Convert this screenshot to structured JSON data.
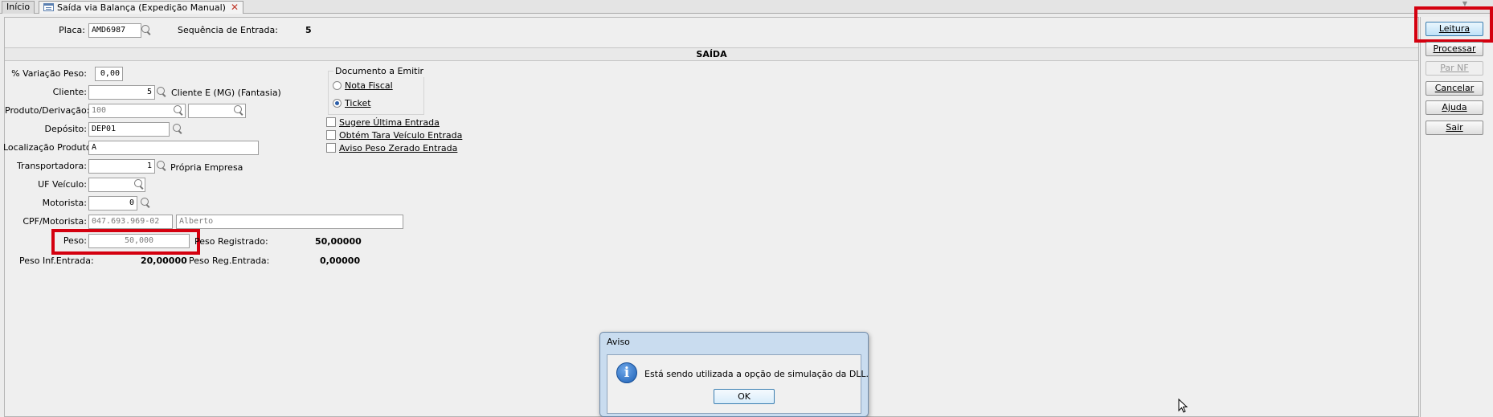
{
  "tabs": [
    {
      "label": "Início"
    },
    {
      "label": "Saída via Balança (Expedição Manual)"
    }
  ],
  "header": {
    "placa_label": "Placa:",
    "placa_value": "AMD6987",
    "sequencia_label": "Sequência de Entrada:",
    "sequencia_value": "5"
  },
  "section_title": "SAÍDA",
  "form": {
    "variacao_label": "% Variação Peso:",
    "variacao_value": "0,00",
    "cliente_label": "Cliente:",
    "cliente_value": "5",
    "cliente_name": "Cliente E (MG) (Fantasia)",
    "produto_label": "Produto/Derivação:",
    "produto_value": "100",
    "derivacao_value": "",
    "deposito_label": "Depósito:",
    "deposito_value": "DEP01",
    "localizacao_label": "Localização Produto:",
    "localizacao_value": "A",
    "transportadora_label": "Transportadora:",
    "transportadora_value": "1",
    "transportadora_name": "Própria Empresa",
    "uf_label": "UF Veículo:",
    "uf_value": "",
    "motorista_label": "Motorista:",
    "motorista_value": "0",
    "cpf_label": "CPF/Motorista:",
    "cpf_value": "047.693.969-02",
    "motorista_name": "Alberto",
    "peso_label": "Peso:",
    "peso_value": "50,000",
    "peso_registrado_label": "Peso Registrado:",
    "peso_registrado_value": "50,00000",
    "peso_inf_label": "Peso Inf.Entrada:",
    "peso_inf_value": "20,00000",
    "peso_reg_label": "Peso Reg.Entrada:",
    "peso_reg_value": "0,00000"
  },
  "documento": {
    "title": "Documento a Emitir",
    "options": [
      {
        "label": "Nota Fiscal",
        "selected": false
      },
      {
        "label": "Ticket",
        "selected": true
      }
    ]
  },
  "checkboxes": [
    {
      "label": "Sugere Última Entrada",
      "checked": false
    },
    {
      "label": "Obtém Tara Veículo Entrada",
      "checked": false
    },
    {
      "label": "Aviso Peso Zerado Entrada",
      "checked": false
    }
  ],
  "buttons": {
    "leitura": "Leitura",
    "processar": "Processar",
    "par_nf": "Par NF",
    "cancelar": "Cancelar",
    "ajuda": "Ajuda",
    "sair": "Sair"
  },
  "dialog": {
    "title": "Aviso",
    "message": "Está sendo utilizada a opção de simulação da DLL.",
    "ok": "OK"
  },
  "colors": {
    "highlight": "#d4000f",
    "dialog_frame": "#c9dcef"
  }
}
